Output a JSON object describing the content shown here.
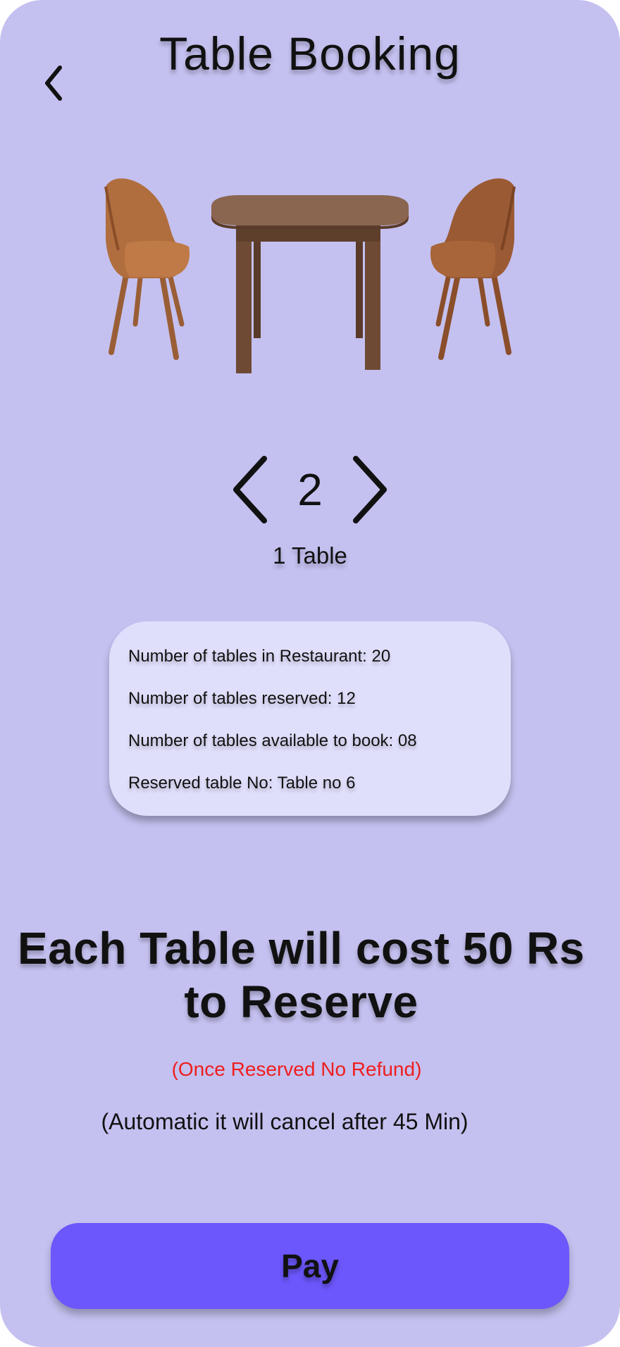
{
  "header": {
    "title": "Table Booking",
    "back_icon": "chevron-left-icon"
  },
  "illustration": {
    "description_icon": "table-with-chairs-image",
    "colors": {
      "table": "#6e4a35",
      "table_top": "#8a6550",
      "chair": "#b06e3f",
      "chair_dark": "#8a4e2a"
    }
  },
  "stepper": {
    "value": "2",
    "decrement_icon": "chevron-left-icon",
    "increment_icon": "chevron-right-icon"
  },
  "table_count_label": "1 Table",
  "info": {
    "total_tables": "Number of tables in Restaurant:  20",
    "reserved_tables": "Number of tables reserved:  12",
    "available_tables": "Number of tables available to book: 08",
    "reserved_table_no": "Reserved table No: Table no 6"
  },
  "cost_notice": {
    "line1": "Each Table will cost 50 Rs",
    "line2": "to Reserve"
  },
  "refund_notice": "(Once Reserved No Refund)",
  "auto_cancel_notice": "(Automatic it will cancel after 45 Min)",
  "pay_button": {
    "label": "Pay"
  },
  "colors": {
    "background": "#c4c1f0",
    "card": "#e0dffb",
    "accent": "#6b57fb",
    "warning": "#ef1e1e"
  }
}
